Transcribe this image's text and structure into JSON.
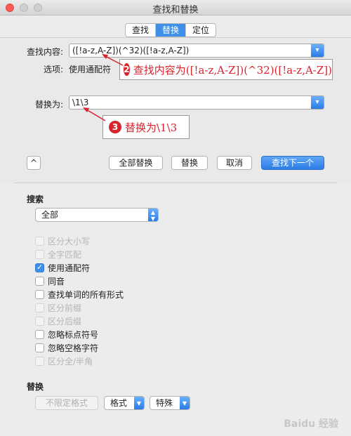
{
  "window": {
    "title": "查找和替换"
  },
  "tabs": [
    {
      "label": "查找"
    },
    {
      "label": "替换"
    },
    {
      "label": "定位"
    }
  ],
  "find": {
    "label": "查找内容:",
    "value": "([!a-z,A-Z])(^32)([!a-z,A-Z])"
  },
  "options": {
    "label": "选项:",
    "value": "使用通配符"
  },
  "replace": {
    "label": "替换为:",
    "value": "\\1\\3"
  },
  "annotations": {
    "a2": {
      "num": "2",
      "text": "查找内容为([!a-z,A-Z])(^32)([!a-z,A-Z])"
    },
    "a3": {
      "num": "3",
      "text": "替换为\\1\\3"
    }
  },
  "buttons": {
    "collapse": "^",
    "replace_all": "全部替换",
    "replace": "替换",
    "cancel": "取消",
    "find_next": "查找下一个"
  },
  "search": {
    "title": "搜索",
    "scope": "全部"
  },
  "checkboxes": [
    {
      "label": "区分大小写",
      "checked": false,
      "enabled": false
    },
    {
      "label": "全字匹配",
      "checked": false,
      "enabled": false
    },
    {
      "label": "使用通配符",
      "checked": true,
      "enabled": true
    },
    {
      "label": "同音",
      "checked": false,
      "enabled": true
    },
    {
      "label": "查找单词的所有形式",
      "checked": false,
      "enabled": true
    },
    {
      "label": "区分前缀",
      "checked": false,
      "enabled": false
    },
    {
      "label": "区分后缀",
      "checked": false,
      "enabled": false
    },
    {
      "label": "忽略标点符号",
      "checked": false,
      "enabled": true
    },
    {
      "label": "忽略空格字符",
      "checked": false,
      "enabled": true
    },
    {
      "label": "区分全/半角",
      "checked": false,
      "enabled": false
    }
  ],
  "replace_section": {
    "title": "替换",
    "no_format": "不限定格式",
    "format": "格式",
    "special": "特殊"
  },
  "watermark": "Baidu 经验",
  "colors": {
    "accent": "#3d8fe8",
    "annotation": "#d9232d"
  }
}
